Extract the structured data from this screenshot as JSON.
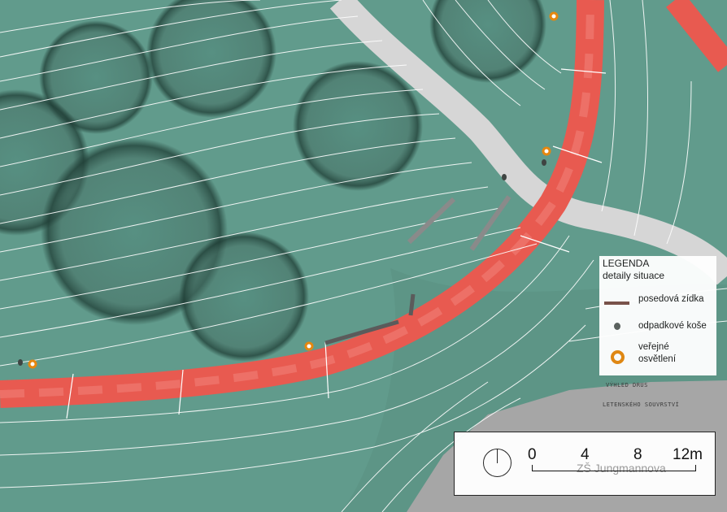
{
  "legend": {
    "title": "LEGENDA",
    "subtitle": "detaily situace",
    "items": [
      {
        "label": "posedová zídka",
        "symbol": "seating-wall",
        "color": "#7a4f47"
      },
      {
        "label": "odpadkové koše",
        "symbol": "trash-bin",
        "color": "#5a5f5d"
      },
      {
        "label_line1": "veřejné",
        "label_line2": "osvětlení",
        "symbol": "street-light",
        "color": "#e5870f"
      }
    ]
  },
  "handwritten_note": {
    "line1": "VÝHLED DRUS",
    "line2": "LETENSKÉHO SOUVRSTVÍ"
  },
  "scale": {
    "labels": [
      "0",
      "4",
      "8",
      "12m"
    ]
  },
  "place_label": "ZŠ Jungmannova",
  "colors": {
    "vegetation": "#5f9a8b",
    "path": "#e85a50",
    "walkway": "#d6d6d6",
    "street": "#a9a9a9",
    "contour": "#ffffff"
  }
}
